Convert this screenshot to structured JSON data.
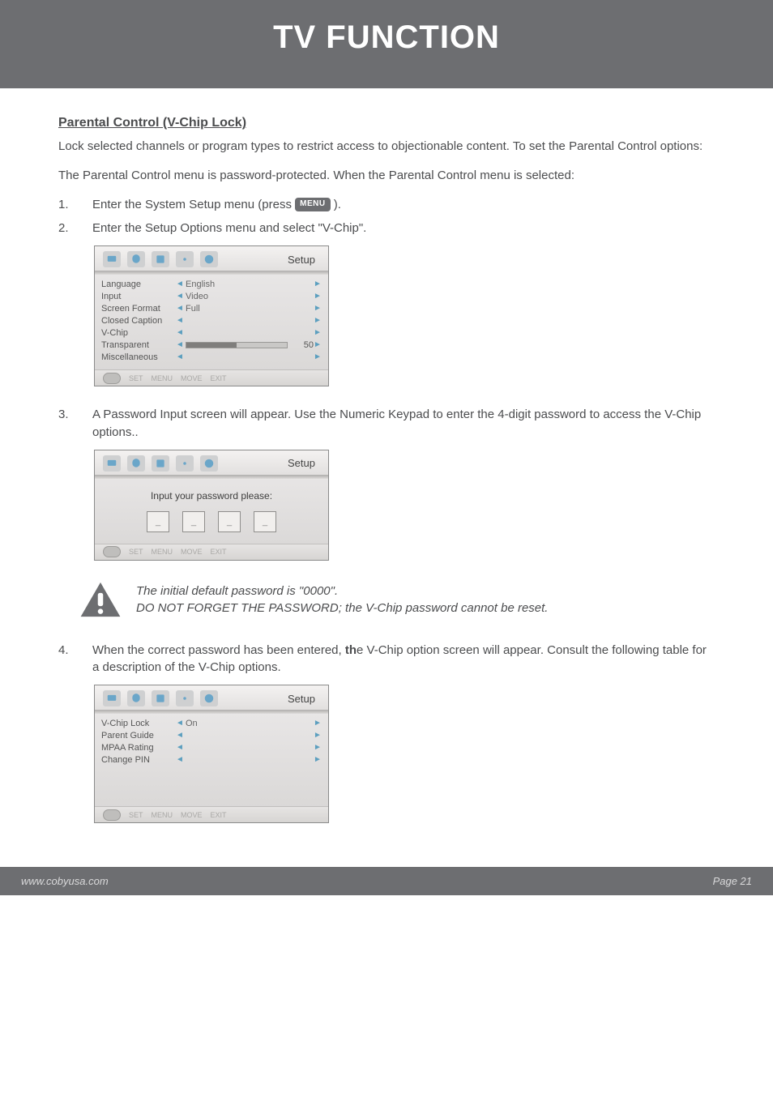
{
  "header": {
    "title": "TV FUNCTION"
  },
  "section": {
    "heading": "Parental Control (V-Chip Lock)",
    "intro": "Lock selected channels or program types to restrict access to objectionable content. To set the Parental Control options:",
    "para_protected": "The Parental Control menu is password-protected. When the Parental Control menu is selected:"
  },
  "steps": {
    "s1_num": "1.",
    "s1_text_a": "Enter the System Setup menu (press ",
    "s1_text_b": ").",
    "s2_num": "2.",
    "s2_text": "Enter the Setup Options menu and select \"V-Chip\".",
    "s3_num": "3.",
    "s3_text": "A Password Input screen will appear. Use the Numeric Keypad to enter the 4-digit password to access the V-Chip options..",
    "s4_num": "4.",
    "s4_text_a": "When the correct password has been entered, ",
    "s4_text_bold": "th",
    "s4_text_b": "e V-Chip option screen will appear. Consult the following table for a description of the V-Chip options."
  },
  "menu_key": "MENU",
  "osd_common": {
    "title": "Setup",
    "footer": {
      "set": "SET",
      "menu": "MENU",
      "move": "MOVE",
      "exit": "EXIT"
    }
  },
  "osd1": {
    "rows": [
      {
        "label": "Language",
        "value": "English"
      },
      {
        "label": "Input",
        "value": "Video"
      },
      {
        "label": "Screen Format",
        "value": "Full"
      },
      {
        "label": "Closed Caption",
        "value": ""
      },
      {
        "label": "V-Chip",
        "value": ""
      }
    ],
    "transparent_label": "Transparent",
    "transparent_value": "50",
    "misc_label": "Miscellaneous"
  },
  "osd2": {
    "prompt": "Input your password please:",
    "placeholder": "_"
  },
  "osd3": {
    "rows": [
      {
        "label": "V-Chip Lock",
        "value": "On"
      },
      {
        "label": "Parent Guide",
        "value": ""
      },
      {
        "label": "MPAA Rating",
        "value": ""
      },
      {
        "label": "Change PIN",
        "value": ""
      }
    ]
  },
  "note": {
    "line1": "The initial default password is \"0000\".",
    "line2": "DO NOT FORGET THE PASSWORD; the V-Chip password cannot be reset."
  },
  "footer": {
    "url": "www.cobyusa.com",
    "page": "Page 21"
  }
}
